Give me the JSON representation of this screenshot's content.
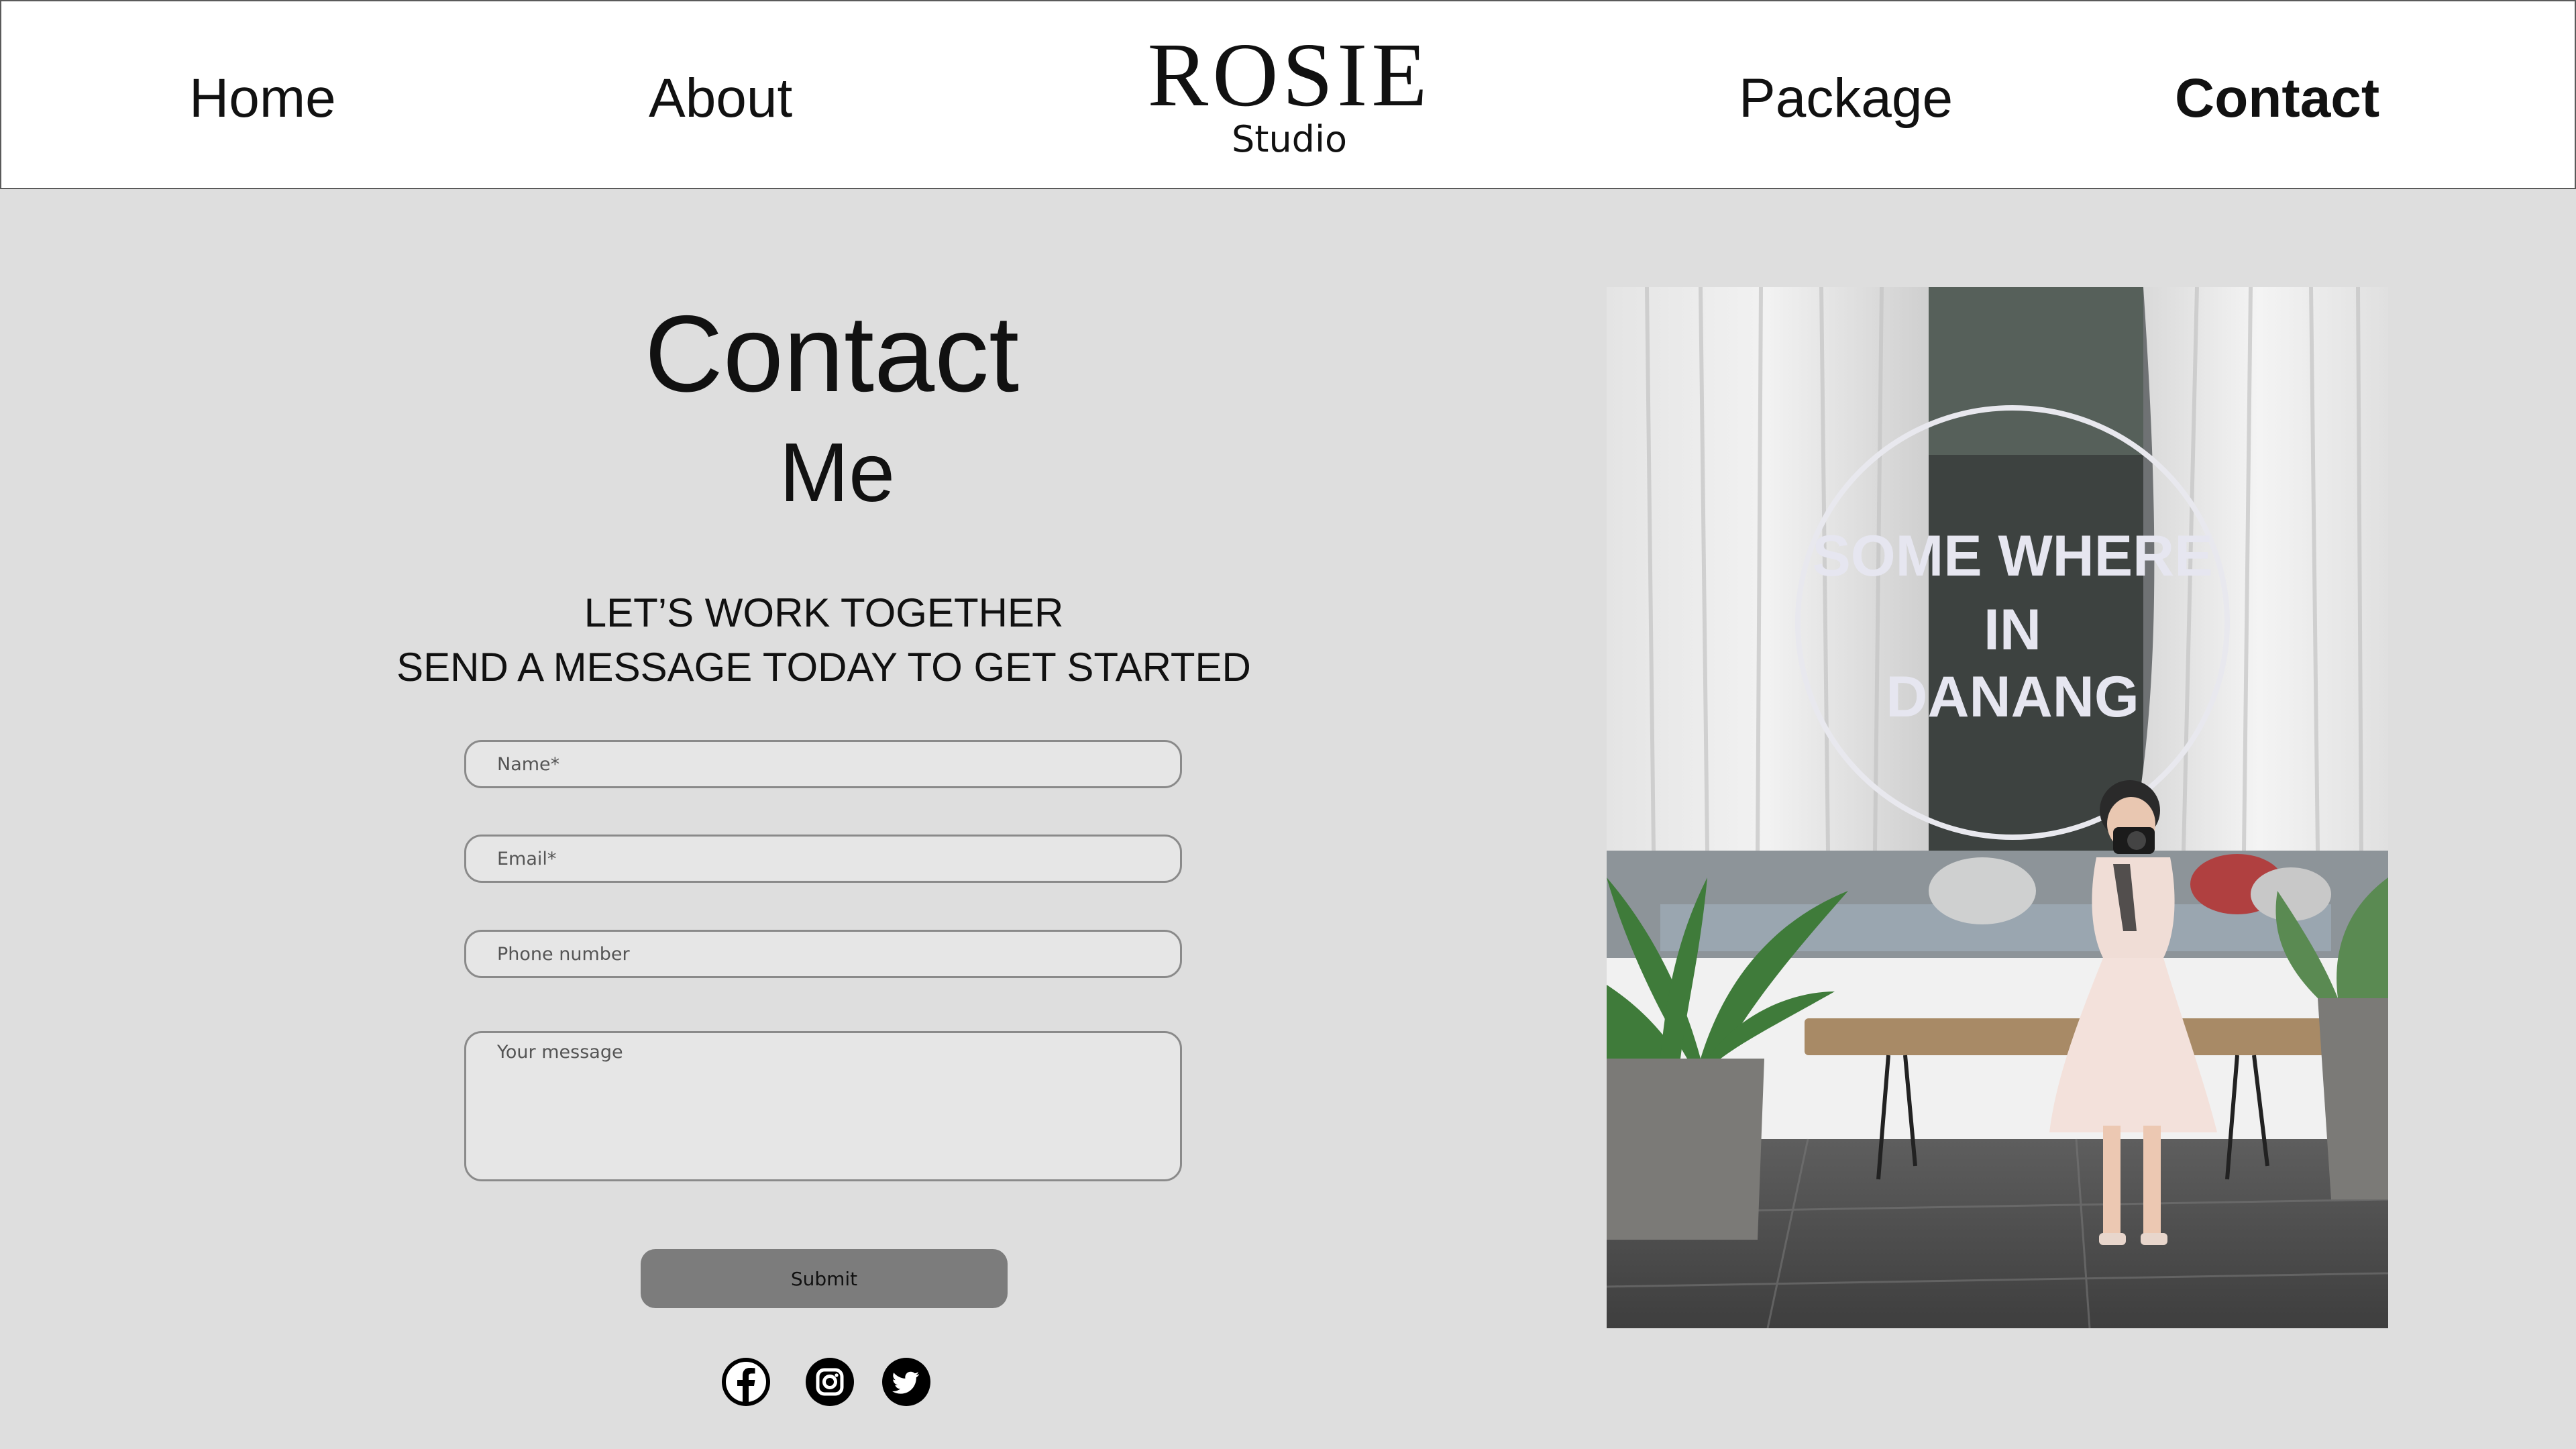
{
  "nav": {
    "home": "Home",
    "about": "About",
    "package": "Package",
    "contact": "Contact"
  },
  "logo": {
    "main": "ROSIE",
    "sub": "Studio"
  },
  "page": {
    "title": "Contact",
    "subtitle": "Me",
    "tagline_1": "LET’S WORK TOGETHER",
    "tagline_2": "SEND A MESSAGE TODAY TO GET STARTED"
  },
  "form": {
    "name_placeholder": "Name*",
    "email_placeholder": "Email*",
    "phone_placeholder": "Phone number",
    "message_placeholder": "Your message",
    "submit_label": "Submit"
  },
  "social": [
    "facebook-icon",
    "instagram-icon",
    "twitter-icon"
  ],
  "photo": {
    "sign_line_1": "SOME WHERE",
    "sign_line_2": "IN",
    "sign_line_3": "DANANG"
  },
  "colors": {
    "background": "#dedede",
    "header_bg": "#ffffff",
    "submit_bg": "#7c7c7c",
    "field_border": "#8a8a8a"
  }
}
